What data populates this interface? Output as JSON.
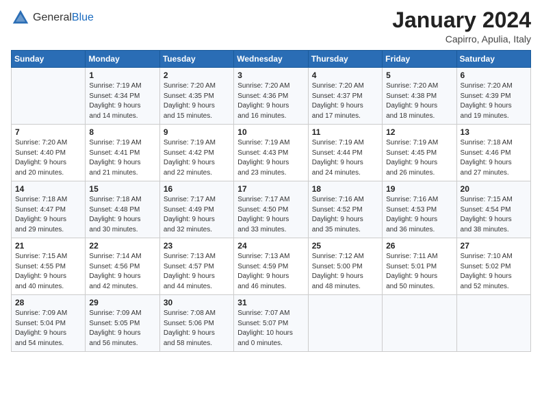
{
  "header": {
    "logo_general": "General",
    "logo_blue": "Blue",
    "month_title": "January 2024",
    "location": "Capirro, Apulia, Italy"
  },
  "columns": [
    "Sunday",
    "Monday",
    "Tuesday",
    "Wednesday",
    "Thursday",
    "Friday",
    "Saturday"
  ],
  "weeks": [
    [
      {
        "day": "",
        "info": ""
      },
      {
        "day": "1",
        "info": "Sunrise: 7:19 AM\nSunset: 4:34 PM\nDaylight: 9 hours\nand 14 minutes."
      },
      {
        "day": "2",
        "info": "Sunrise: 7:20 AM\nSunset: 4:35 PM\nDaylight: 9 hours\nand 15 minutes."
      },
      {
        "day": "3",
        "info": "Sunrise: 7:20 AM\nSunset: 4:36 PM\nDaylight: 9 hours\nand 16 minutes."
      },
      {
        "day": "4",
        "info": "Sunrise: 7:20 AM\nSunset: 4:37 PM\nDaylight: 9 hours\nand 17 minutes."
      },
      {
        "day": "5",
        "info": "Sunrise: 7:20 AM\nSunset: 4:38 PM\nDaylight: 9 hours\nand 18 minutes."
      },
      {
        "day": "6",
        "info": "Sunrise: 7:20 AM\nSunset: 4:39 PM\nDaylight: 9 hours\nand 19 minutes."
      }
    ],
    [
      {
        "day": "7",
        "info": "Sunrise: 7:20 AM\nSunset: 4:40 PM\nDaylight: 9 hours\nand 20 minutes."
      },
      {
        "day": "8",
        "info": "Sunrise: 7:19 AM\nSunset: 4:41 PM\nDaylight: 9 hours\nand 21 minutes."
      },
      {
        "day": "9",
        "info": "Sunrise: 7:19 AM\nSunset: 4:42 PM\nDaylight: 9 hours\nand 22 minutes."
      },
      {
        "day": "10",
        "info": "Sunrise: 7:19 AM\nSunset: 4:43 PM\nDaylight: 9 hours\nand 23 minutes."
      },
      {
        "day": "11",
        "info": "Sunrise: 7:19 AM\nSunset: 4:44 PM\nDaylight: 9 hours\nand 24 minutes."
      },
      {
        "day": "12",
        "info": "Sunrise: 7:19 AM\nSunset: 4:45 PM\nDaylight: 9 hours\nand 26 minutes."
      },
      {
        "day": "13",
        "info": "Sunrise: 7:18 AM\nSunset: 4:46 PM\nDaylight: 9 hours\nand 27 minutes."
      }
    ],
    [
      {
        "day": "14",
        "info": "Sunrise: 7:18 AM\nSunset: 4:47 PM\nDaylight: 9 hours\nand 29 minutes."
      },
      {
        "day": "15",
        "info": "Sunrise: 7:18 AM\nSunset: 4:48 PM\nDaylight: 9 hours\nand 30 minutes."
      },
      {
        "day": "16",
        "info": "Sunrise: 7:17 AM\nSunset: 4:49 PM\nDaylight: 9 hours\nand 32 minutes."
      },
      {
        "day": "17",
        "info": "Sunrise: 7:17 AM\nSunset: 4:50 PM\nDaylight: 9 hours\nand 33 minutes."
      },
      {
        "day": "18",
        "info": "Sunrise: 7:16 AM\nSunset: 4:52 PM\nDaylight: 9 hours\nand 35 minutes."
      },
      {
        "day": "19",
        "info": "Sunrise: 7:16 AM\nSunset: 4:53 PM\nDaylight: 9 hours\nand 36 minutes."
      },
      {
        "day": "20",
        "info": "Sunrise: 7:15 AM\nSunset: 4:54 PM\nDaylight: 9 hours\nand 38 minutes."
      }
    ],
    [
      {
        "day": "21",
        "info": "Sunrise: 7:15 AM\nSunset: 4:55 PM\nDaylight: 9 hours\nand 40 minutes."
      },
      {
        "day": "22",
        "info": "Sunrise: 7:14 AM\nSunset: 4:56 PM\nDaylight: 9 hours\nand 42 minutes."
      },
      {
        "day": "23",
        "info": "Sunrise: 7:13 AM\nSunset: 4:57 PM\nDaylight: 9 hours\nand 44 minutes."
      },
      {
        "day": "24",
        "info": "Sunrise: 7:13 AM\nSunset: 4:59 PM\nDaylight: 9 hours\nand 46 minutes."
      },
      {
        "day": "25",
        "info": "Sunrise: 7:12 AM\nSunset: 5:00 PM\nDaylight: 9 hours\nand 48 minutes."
      },
      {
        "day": "26",
        "info": "Sunrise: 7:11 AM\nSunset: 5:01 PM\nDaylight: 9 hours\nand 50 minutes."
      },
      {
        "day": "27",
        "info": "Sunrise: 7:10 AM\nSunset: 5:02 PM\nDaylight: 9 hours\nand 52 minutes."
      }
    ],
    [
      {
        "day": "28",
        "info": "Sunrise: 7:09 AM\nSunset: 5:04 PM\nDaylight: 9 hours\nand 54 minutes."
      },
      {
        "day": "29",
        "info": "Sunrise: 7:09 AM\nSunset: 5:05 PM\nDaylight: 9 hours\nand 56 minutes."
      },
      {
        "day": "30",
        "info": "Sunrise: 7:08 AM\nSunset: 5:06 PM\nDaylight: 9 hours\nand 58 minutes."
      },
      {
        "day": "31",
        "info": "Sunrise: 7:07 AM\nSunset: 5:07 PM\nDaylight: 10 hours\nand 0 minutes."
      },
      {
        "day": "",
        "info": ""
      },
      {
        "day": "",
        "info": ""
      },
      {
        "day": "",
        "info": ""
      }
    ]
  ]
}
